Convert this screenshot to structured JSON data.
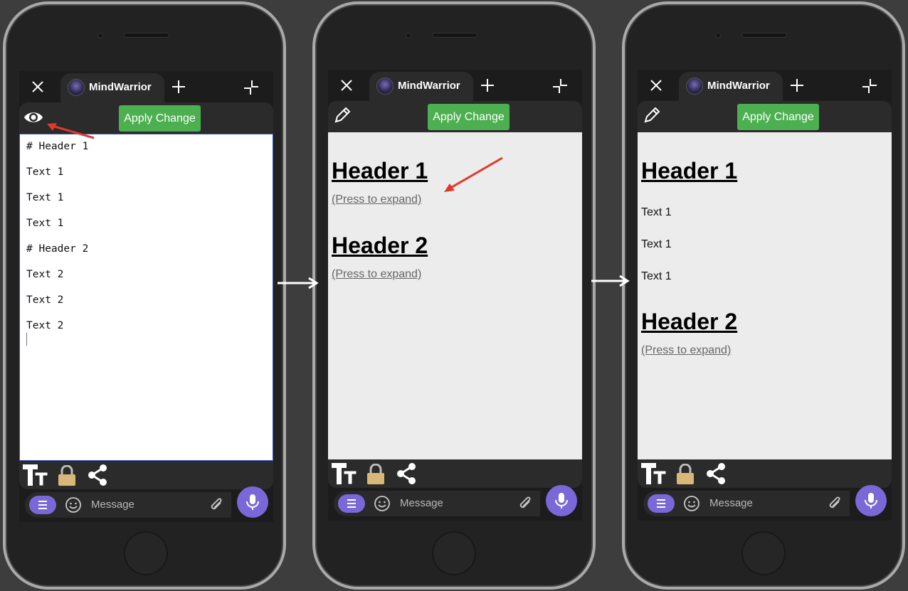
{
  "app": {
    "title": "MindWarrior",
    "apply_label": "Apply Change",
    "message_placeholder": "Message"
  },
  "colors": {
    "apply_button": "#4caf50",
    "accent_purple": "#7b68d8",
    "annotation_arrow": "#e0392b",
    "preview_background": "#ececec",
    "editor_border": "#3a55c8"
  },
  "icons": {
    "edit_mode_toggle_step1": "eye-icon",
    "edit_mode_toggle_step2": "pencil-icon",
    "format": "text-size-icon",
    "lock": "padlock-icon",
    "share": "share-icon",
    "emoji": "smiley-icon",
    "attach": "paperclip-icon",
    "voice": "microphone-icon"
  },
  "phones": [
    {
      "mode": "edit",
      "editor_lines": [
        "# Header 1",
        "Text 1",
        "Text 1",
        "Text 1",
        "# Header 2",
        "Text 2",
        "Text 2",
        "Text 2"
      ]
    },
    {
      "mode": "preview-collapsed",
      "sections": [
        {
          "header": "Header 1",
          "expand_label": "(Press to expand)"
        },
        {
          "header": "Header 2",
          "expand_label": "(Press to expand)"
        }
      ]
    },
    {
      "mode": "preview-expanded",
      "sections": [
        {
          "header": "Header 1",
          "lines": [
            "Text 1",
            "Text 1",
            "Text 1"
          ]
        },
        {
          "header": "Header 2",
          "expand_label": "(Press to expand)"
        }
      ]
    }
  ]
}
